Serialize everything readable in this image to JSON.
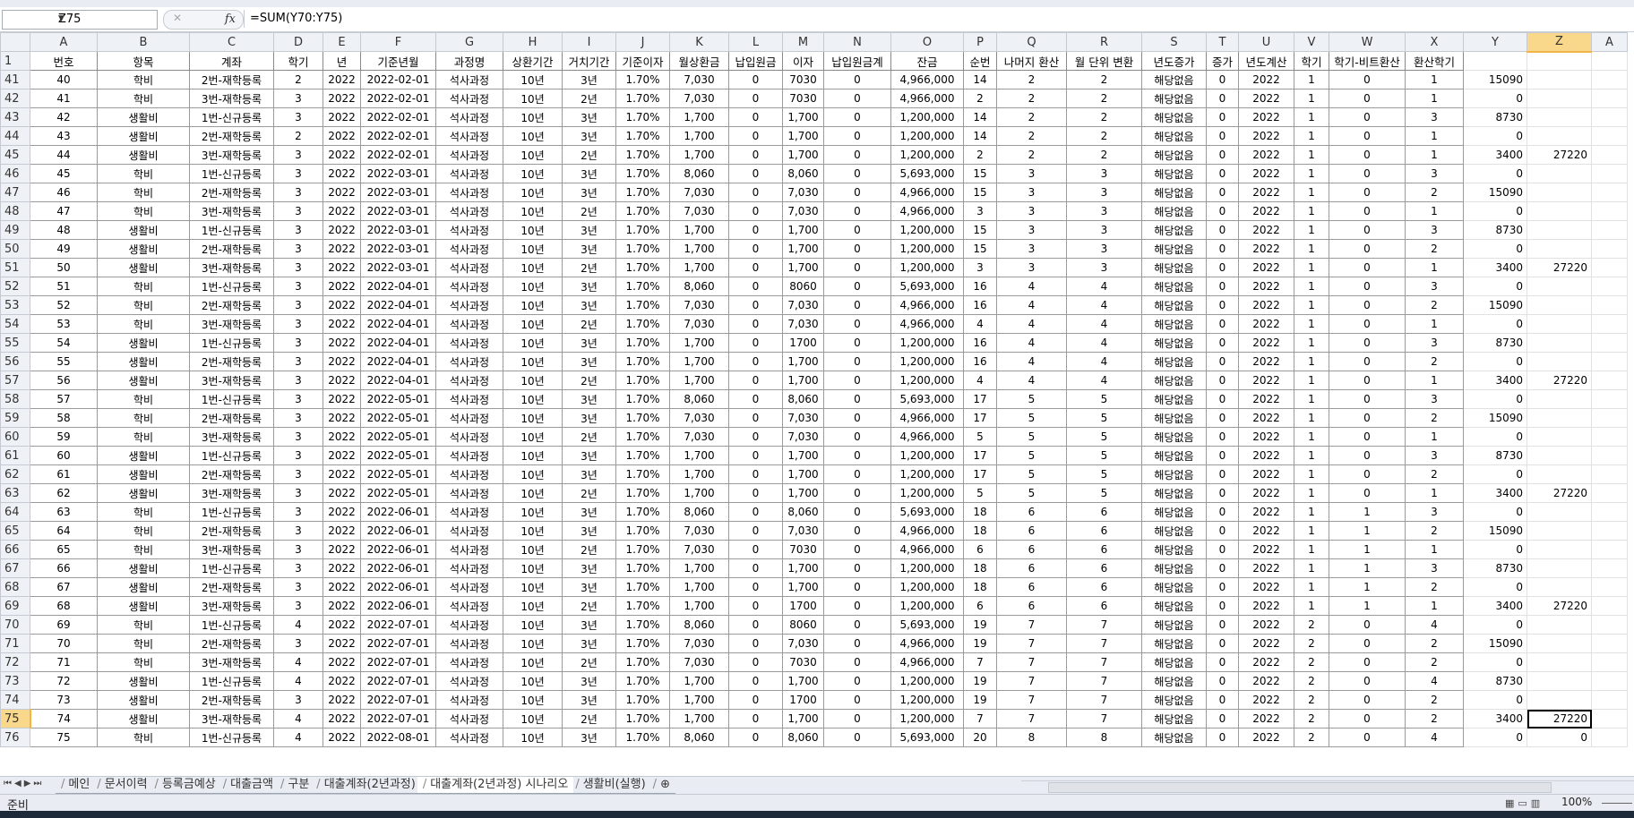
{
  "formula_bar": {
    "name_box": "Z75",
    "formula": "=SUM(Y70:Y75)",
    "fx": "fx",
    "cancel": "✕"
  },
  "columns": [
    "A",
    "B",
    "C",
    "D",
    "E",
    "F",
    "G",
    "H",
    "I",
    "J",
    "K",
    "L",
    "M",
    "N",
    "O",
    "P",
    "Q",
    "R",
    "S",
    "T",
    "U",
    "V",
    "W",
    "X",
    "Y",
    "Z",
    "A"
  ],
  "header_row": {
    "row": "1",
    "cells": [
      "번호",
      "항목",
      "계좌",
      "학기",
      "년",
      "기준년월",
      "과정명",
      "상환기간",
      "거치기간",
      "기준이자",
      "월상환금",
      "납입원금",
      "이자",
      "납입원금계",
      "잔금",
      "순번",
      "나머지 환산",
      "월 단위 변환",
      "년도증가",
      "증가",
      "년도계산",
      "학기",
      "학기-비트환산",
      "환산학기"
    ]
  },
  "rows": [
    {
      "r": "41",
      "c": [
        "40",
        "학비",
        "2번-재학등록",
        "2",
        "2022",
        "2022-02-01",
        "석사과정",
        "10년",
        "3년",
        "1.70%",
        "7,030",
        "0",
        "7030",
        "0",
        "4,966,000",
        "14",
        "2",
        "2",
        "해당없음",
        "0",
        "2022",
        "1",
        "0",
        "1",
        "15090",
        ""
      ]
    },
    {
      "r": "42",
      "c": [
        "41",
        "학비",
        "3번-재학등록",
        "3",
        "2022",
        "2022-02-01",
        "석사과정",
        "10년",
        "2년",
        "1.70%",
        "7,030",
        "0",
        "7030",
        "0",
        "4,966,000",
        "2",
        "2",
        "2",
        "해당없음",
        "0",
        "2022",
        "1",
        "0",
        "1",
        "0",
        ""
      ]
    },
    {
      "r": "43",
      "c": [
        "42",
        "생활비",
        "1번-신규등록",
        "3",
        "2022",
        "2022-02-01",
        "석사과정",
        "10년",
        "3년",
        "1.70%",
        "1,700",
        "0",
        "1,700",
        "0",
        "1,200,000",
        "14",
        "2",
        "2",
        "해당없음",
        "0",
        "2022",
        "1",
        "0",
        "3",
        "8730",
        ""
      ]
    },
    {
      "r": "44",
      "c": [
        "43",
        "생활비",
        "2번-재학등록",
        "2",
        "2022",
        "2022-02-01",
        "석사과정",
        "10년",
        "3년",
        "1.70%",
        "1,700",
        "0",
        "1,700",
        "0",
        "1,200,000",
        "14",
        "2",
        "2",
        "해당없음",
        "0",
        "2022",
        "1",
        "0",
        "1",
        "0",
        ""
      ]
    },
    {
      "r": "45",
      "c": [
        "44",
        "생활비",
        "3번-재학등록",
        "3",
        "2022",
        "2022-02-01",
        "석사과정",
        "10년",
        "2년",
        "1.70%",
        "1,700",
        "0",
        "1,700",
        "0",
        "1,200,000",
        "2",
        "2",
        "2",
        "해당없음",
        "0",
        "2022",
        "1",
        "0",
        "1",
        "3400",
        "27220"
      ]
    },
    {
      "r": "46",
      "c": [
        "45",
        "학비",
        "1번-신규등록",
        "3",
        "2022",
        "2022-03-01",
        "석사과정",
        "10년",
        "3년",
        "1.70%",
        "8,060",
        "0",
        "8,060",
        "0",
        "5,693,000",
        "15",
        "3",
        "3",
        "해당없음",
        "0",
        "2022",
        "1",
        "0",
        "3",
        "0",
        ""
      ]
    },
    {
      "r": "47",
      "c": [
        "46",
        "학비",
        "2번-재학등록",
        "3",
        "2022",
        "2022-03-01",
        "석사과정",
        "10년",
        "3년",
        "1.70%",
        "7,030",
        "0",
        "7,030",
        "0",
        "4,966,000",
        "15",
        "3",
        "3",
        "해당없음",
        "0",
        "2022",
        "1",
        "0",
        "2",
        "15090",
        ""
      ]
    },
    {
      "r": "48",
      "c": [
        "47",
        "학비",
        "3번-재학등록",
        "3",
        "2022",
        "2022-03-01",
        "석사과정",
        "10년",
        "2년",
        "1.70%",
        "7,030",
        "0",
        "7,030",
        "0",
        "4,966,000",
        "3",
        "3",
        "3",
        "해당없음",
        "0",
        "2022",
        "1",
        "0",
        "1",
        "0",
        ""
      ]
    },
    {
      "r": "49",
      "c": [
        "48",
        "생활비",
        "1번-신규등록",
        "3",
        "2022",
        "2022-03-01",
        "석사과정",
        "10년",
        "3년",
        "1.70%",
        "1,700",
        "0",
        "1,700",
        "0",
        "1,200,000",
        "15",
        "3",
        "3",
        "해당없음",
        "0",
        "2022",
        "1",
        "0",
        "3",
        "8730",
        ""
      ]
    },
    {
      "r": "50",
      "c": [
        "49",
        "생활비",
        "2번-재학등록",
        "3",
        "2022",
        "2022-03-01",
        "석사과정",
        "10년",
        "3년",
        "1.70%",
        "1,700",
        "0",
        "1,700",
        "0",
        "1,200,000",
        "15",
        "3",
        "3",
        "해당없음",
        "0",
        "2022",
        "1",
        "0",
        "2",
        "0",
        ""
      ]
    },
    {
      "r": "51",
      "c": [
        "50",
        "생활비",
        "3번-재학등록",
        "3",
        "2022",
        "2022-03-01",
        "석사과정",
        "10년",
        "2년",
        "1.70%",
        "1,700",
        "0",
        "1,700",
        "0",
        "1,200,000",
        "3",
        "3",
        "3",
        "해당없음",
        "0",
        "2022",
        "1",
        "0",
        "1",
        "3400",
        "27220"
      ]
    },
    {
      "r": "52",
      "c": [
        "51",
        "학비",
        "1번-신규등록",
        "3",
        "2022",
        "2022-04-01",
        "석사과정",
        "10년",
        "3년",
        "1.70%",
        "8,060",
        "0",
        "8060",
        "0",
        "5,693,000",
        "16",
        "4",
        "4",
        "해당없음",
        "0",
        "2022",
        "1",
        "0",
        "3",
        "0",
        ""
      ]
    },
    {
      "r": "53",
      "c": [
        "52",
        "학비",
        "2번-재학등록",
        "3",
        "2022",
        "2022-04-01",
        "석사과정",
        "10년",
        "3년",
        "1.70%",
        "7,030",
        "0",
        "7,030",
        "0",
        "4,966,000",
        "16",
        "4",
        "4",
        "해당없음",
        "0",
        "2022",
        "1",
        "0",
        "2",
        "15090",
        ""
      ]
    },
    {
      "r": "54",
      "c": [
        "53",
        "학비",
        "3번-재학등록",
        "3",
        "2022",
        "2022-04-01",
        "석사과정",
        "10년",
        "2년",
        "1.70%",
        "7,030",
        "0",
        "7,030",
        "0",
        "4,966,000",
        "4",
        "4",
        "4",
        "해당없음",
        "0",
        "2022",
        "1",
        "0",
        "1",
        "0",
        ""
      ]
    },
    {
      "r": "55",
      "c": [
        "54",
        "생활비",
        "1번-신규등록",
        "3",
        "2022",
        "2022-04-01",
        "석사과정",
        "10년",
        "3년",
        "1.70%",
        "1,700",
        "0",
        "1700",
        "0",
        "1,200,000",
        "16",
        "4",
        "4",
        "해당없음",
        "0",
        "2022",
        "1",
        "0",
        "3",
        "8730",
        ""
      ]
    },
    {
      "r": "56",
      "c": [
        "55",
        "생활비",
        "2번-재학등록",
        "3",
        "2022",
        "2022-04-01",
        "석사과정",
        "10년",
        "3년",
        "1.70%",
        "1,700",
        "0",
        "1,700",
        "0",
        "1,200,000",
        "16",
        "4",
        "4",
        "해당없음",
        "0",
        "2022",
        "1",
        "0",
        "2",
        "0",
        ""
      ]
    },
    {
      "r": "57",
      "c": [
        "56",
        "생활비",
        "3번-재학등록",
        "3",
        "2022",
        "2022-04-01",
        "석사과정",
        "10년",
        "2년",
        "1.70%",
        "1,700",
        "0",
        "1,700",
        "0",
        "1,200,000",
        "4",
        "4",
        "4",
        "해당없음",
        "0",
        "2022",
        "1",
        "0",
        "1",
        "3400",
        "27220"
      ]
    },
    {
      "r": "58",
      "c": [
        "57",
        "학비",
        "1번-신규등록",
        "3",
        "2022",
        "2022-05-01",
        "석사과정",
        "10년",
        "3년",
        "1.70%",
        "8,060",
        "0",
        "8,060",
        "0",
        "5,693,000",
        "17",
        "5",
        "5",
        "해당없음",
        "0",
        "2022",
        "1",
        "0",
        "3",
        "0",
        ""
      ]
    },
    {
      "r": "59",
      "c": [
        "58",
        "학비",
        "2번-재학등록",
        "3",
        "2022",
        "2022-05-01",
        "석사과정",
        "10년",
        "3년",
        "1.70%",
        "7,030",
        "0",
        "7,030",
        "0",
        "4,966,000",
        "17",
        "5",
        "5",
        "해당없음",
        "0",
        "2022",
        "1",
        "0",
        "2",
        "15090",
        ""
      ]
    },
    {
      "r": "60",
      "c": [
        "59",
        "학비",
        "3번-재학등록",
        "3",
        "2022",
        "2022-05-01",
        "석사과정",
        "10년",
        "2년",
        "1.70%",
        "7,030",
        "0",
        "7,030",
        "0",
        "4,966,000",
        "5",
        "5",
        "5",
        "해당없음",
        "0",
        "2022",
        "1",
        "0",
        "1",
        "0",
        ""
      ]
    },
    {
      "r": "61",
      "c": [
        "60",
        "생활비",
        "1번-신규등록",
        "3",
        "2022",
        "2022-05-01",
        "석사과정",
        "10년",
        "3년",
        "1.70%",
        "1,700",
        "0",
        "1,700",
        "0",
        "1,200,000",
        "17",
        "5",
        "5",
        "해당없음",
        "0",
        "2022",
        "1",
        "0",
        "3",
        "8730",
        ""
      ]
    },
    {
      "r": "62",
      "c": [
        "61",
        "생활비",
        "2번-재학등록",
        "3",
        "2022",
        "2022-05-01",
        "석사과정",
        "10년",
        "3년",
        "1.70%",
        "1,700",
        "0",
        "1,700",
        "0",
        "1,200,000",
        "17",
        "5",
        "5",
        "해당없음",
        "0",
        "2022",
        "1",
        "0",
        "2",
        "0",
        ""
      ]
    },
    {
      "r": "63",
      "c": [
        "62",
        "생활비",
        "3번-재학등록",
        "3",
        "2022",
        "2022-05-01",
        "석사과정",
        "10년",
        "2년",
        "1.70%",
        "1,700",
        "0",
        "1,700",
        "0",
        "1,200,000",
        "5",
        "5",
        "5",
        "해당없음",
        "0",
        "2022",
        "1",
        "0",
        "1",
        "3400",
        "27220"
      ]
    },
    {
      "r": "64",
      "c": [
        "63",
        "학비",
        "1번-신규등록",
        "3",
        "2022",
        "2022-06-01",
        "석사과정",
        "10년",
        "3년",
        "1.70%",
        "8,060",
        "0",
        "8,060",
        "0",
        "5,693,000",
        "18",
        "6",
        "6",
        "해당없음",
        "0",
        "2022",
        "1",
        "1",
        "3",
        "0",
        ""
      ]
    },
    {
      "r": "65",
      "c": [
        "64",
        "학비",
        "2번-재학등록",
        "3",
        "2022",
        "2022-06-01",
        "석사과정",
        "10년",
        "3년",
        "1.70%",
        "7,030",
        "0",
        "7,030",
        "0",
        "4,966,000",
        "18",
        "6",
        "6",
        "해당없음",
        "0",
        "2022",
        "1",
        "1",
        "2",
        "15090",
        ""
      ]
    },
    {
      "r": "66",
      "c": [
        "65",
        "학비",
        "3번-재학등록",
        "3",
        "2022",
        "2022-06-01",
        "석사과정",
        "10년",
        "2년",
        "1.70%",
        "7,030",
        "0",
        "7030",
        "0",
        "4,966,000",
        "6",
        "6",
        "6",
        "해당없음",
        "0",
        "2022",
        "1",
        "1",
        "1",
        "0",
        ""
      ]
    },
    {
      "r": "67",
      "c": [
        "66",
        "생활비",
        "1번-신규등록",
        "3",
        "2022",
        "2022-06-01",
        "석사과정",
        "10년",
        "3년",
        "1.70%",
        "1,700",
        "0",
        "1,700",
        "0",
        "1,200,000",
        "18",
        "6",
        "6",
        "해당없음",
        "0",
        "2022",
        "1",
        "1",
        "3",
        "8730",
        ""
      ]
    },
    {
      "r": "68",
      "c": [
        "67",
        "생활비",
        "2번-재학등록",
        "3",
        "2022",
        "2022-06-01",
        "석사과정",
        "10년",
        "3년",
        "1.70%",
        "1,700",
        "0",
        "1,700",
        "0",
        "1,200,000",
        "18",
        "6",
        "6",
        "해당없음",
        "0",
        "2022",
        "1",
        "1",
        "2",
        "0",
        ""
      ]
    },
    {
      "r": "69",
      "c": [
        "68",
        "생활비",
        "3번-재학등록",
        "3",
        "2022",
        "2022-06-01",
        "석사과정",
        "10년",
        "2년",
        "1.70%",
        "1,700",
        "0",
        "1700",
        "0",
        "1,200,000",
        "6",
        "6",
        "6",
        "해당없음",
        "0",
        "2022",
        "1",
        "1",
        "1",
        "3400",
        "27220"
      ]
    },
    {
      "r": "70",
      "c": [
        "69",
        "학비",
        "1번-신규등록",
        "4",
        "2022",
        "2022-07-01",
        "석사과정",
        "10년",
        "3년",
        "1.70%",
        "8,060",
        "0",
        "8060",
        "0",
        "5,693,000",
        "19",
        "7",
        "7",
        "해당없음",
        "0",
        "2022",
        "2",
        "0",
        "4",
        "0",
        ""
      ]
    },
    {
      "r": "71",
      "c": [
        "70",
        "학비",
        "2번-재학등록",
        "3",
        "2022",
        "2022-07-01",
        "석사과정",
        "10년",
        "3년",
        "1.70%",
        "7,030",
        "0",
        "7,030",
        "0",
        "4,966,000",
        "19",
        "7",
        "7",
        "해당없음",
        "0",
        "2022",
        "2",
        "0",
        "2",
        "15090",
        ""
      ]
    },
    {
      "r": "72",
      "c": [
        "71",
        "학비",
        "3번-재학등록",
        "4",
        "2022",
        "2022-07-01",
        "석사과정",
        "10년",
        "2년",
        "1.70%",
        "7,030",
        "0",
        "7030",
        "0",
        "4,966,000",
        "7",
        "7",
        "7",
        "해당없음",
        "0",
        "2022",
        "2",
        "0",
        "2",
        "0",
        ""
      ]
    },
    {
      "r": "73",
      "c": [
        "72",
        "생활비",
        "1번-신규등록",
        "4",
        "2022",
        "2022-07-01",
        "석사과정",
        "10년",
        "3년",
        "1.70%",
        "1,700",
        "0",
        "1,700",
        "0",
        "1,200,000",
        "19",
        "7",
        "7",
        "해당없음",
        "0",
        "2022",
        "2",
        "0",
        "4",
        "8730",
        ""
      ]
    },
    {
      "r": "74",
      "c": [
        "73",
        "생활비",
        "2번-재학등록",
        "3",
        "2022",
        "2022-07-01",
        "석사과정",
        "10년",
        "3년",
        "1.70%",
        "1,700",
        "0",
        "1700",
        "0",
        "1,200,000",
        "19",
        "7",
        "7",
        "해당없음",
        "0",
        "2022",
        "2",
        "0",
        "2",
        "0",
        ""
      ]
    },
    {
      "r": "75",
      "c": [
        "74",
        "생활비",
        "3번-재학등록",
        "4",
        "2022",
        "2022-07-01",
        "석사과정",
        "10년",
        "2년",
        "1.70%",
        "1,700",
        "0",
        "1,700",
        "0",
        "1,200,000",
        "7",
        "7",
        "7",
        "해당없음",
        "0",
        "2022",
        "2",
        "0",
        "2",
        "3400",
        "27220"
      ]
    },
    {
      "r": "76",
      "c": [
        "75",
        "학비",
        "1번-신규등록",
        "4",
        "2022",
        "2022-08-01",
        "석사과정",
        "10년",
        "3년",
        "1.70%",
        "8,060",
        "0",
        "8,060",
        "0",
        "5,693,000",
        "20",
        "8",
        "8",
        "해당없음",
        "0",
        "2022",
        "2",
        "0",
        "4",
        "0",
        "0"
      ]
    }
  ],
  "sheet_tabs": [
    "메인",
    "문서이력",
    "등록금예상",
    "대출금액",
    "구분",
    "대출계좌(2년과정)",
    "대출계좌(2년과정) 시나리오",
    "생활비(실행)"
  ],
  "active_tab_index": 6,
  "status": {
    "ready": "준비",
    "zoom": "100%"
  }
}
